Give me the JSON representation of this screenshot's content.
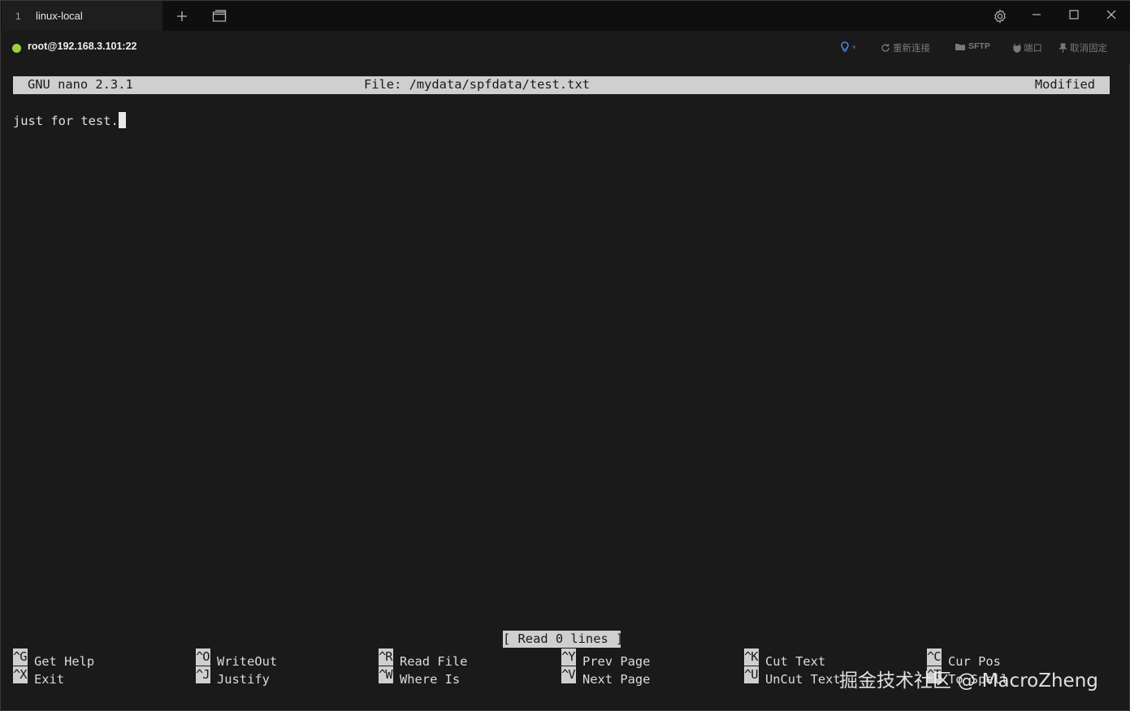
{
  "window": {
    "tab": {
      "number": "1",
      "title": "linux-local"
    }
  },
  "session": {
    "host": "root@192.168.3.101:22",
    "status_color": "#9ad33c",
    "actions": {
      "reconnect": "重新连接",
      "sftp": "SFTP",
      "port": "端口",
      "unpin": "取消固定"
    }
  },
  "nano": {
    "version": "GNU nano 2.3.1",
    "file": "File: /mydata/spfdata/test.txt",
    "state": "Modified",
    "content": "just for test.",
    "status_message": "[ Read 0 lines ]",
    "shortcuts": [
      {
        "key": "^G",
        "label": "Get Help"
      },
      {
        "key": "^O",
        "label": "WriteOut"
      },
      {
        "key": "^R",
        "label": "Read File"
      },
      {
        "key": "^Y",
        "label": "Prev Page"
      },
      {
        "key": "^K",
        "label": "Cut Text"
      },
      {
        "key": "^C",
        "label": "Cur Pos"
      },
      {
        "key": "^X",
        "label": "Exit"
      },
      {
        "key": "^J",
        "label": "Justify"
      },
      {
        "key": "^W",
        "label": "Where Is"
      },
      {
        "key": "^V",
        "label": "Next Page"
      },
      {
        "key": "^U",
        "label": "UnCut Text"
      },
      {
        "key": "^T",
        "label": "To Spell"
      }
    ]
  },
  "watermark": "掘金技术社区 @ MacroZheng",
  "icons": {
    "new_tab": "plus-icon",
    "tab_overview": "window-icon",
    "settings": "gear-icon",
    "minimize": "minimize-icon",
    "maximize": "maximize-icon",
    "close": "close-icon",
    "tips": "lightbulb-icon",
    "reconnect": "refresh-icon",
    "sftp": "folder-icon",
    "port": "plug-icon",
    "unpin": "pin-icon"
  }
}
